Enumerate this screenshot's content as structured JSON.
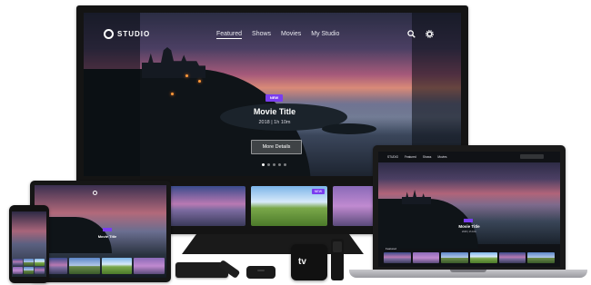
{
  "tv": {
    "logo_text": "STUDIO",
    "nav": [
      "Featured",
      "Shows",
      "Movies",
      "My Studio"
    ],
    "icons": [
      "search-icon",
      "gear-icon"
    ],
    "hero": {
      "badge": "NEW",
      "title": "Movie Title",
      "meta": "2018 | 1h 10m",
      "button": "More Details"
    },
    "row_badges": [
      "NEW"
    ]
  },
  "devices": {
    "apple_tv_logo": "tv"
  },
  "colors": {
    "accent": "#7a3df0",
    "device_body": "#141414",
    "background": "#ffffff"
  }
}
